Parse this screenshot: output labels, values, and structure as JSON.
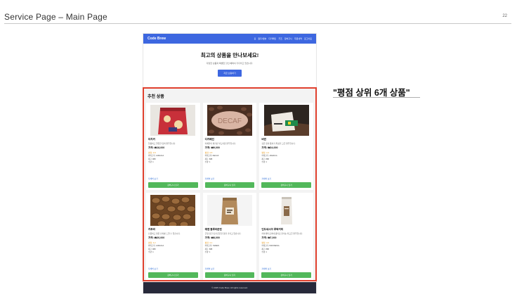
{
  "slide": {
    "title": "Service Page – Main Page",
    "page_number": "22"
  },
  "nav": {
    "brand": "Code Brew",
    "links": [
      "홈",
      "원두/캡슐",
      "디카페인",
      "굿즈",
      "장바구니",
      "주문내역",
      "로그아웃"
    ]
  },
  "hero": {
    "title": "최고의 상품을 만나보세요!",
    "subtitle": "다양한 상품과 특별한 할인 혜택이 기다리고 있습니다.",
    "button": "지금 쇼핑하기"
  },
  "section": {
    "title": "추천 상품"
  },
  "products": [
    {
      "name": "더치커",
      "desc": "달콤하고 깔끔한 맛의 원두입니다.",
      "price": "가격: ₩18,000",
      "rating": "평점: 4.8",
      "meta1": "카테고리: JAMAICA",
      "meta2": "재고: 888",
      "qty": "수량: 1",
      "detail": "자세히 보기",
      "cart": "장바구니 담기",
      "image": "coffee-bag-red"
    },
    {
      "name": "디카페인",
      "desc": "카페인이 제거된 부드러운 원두입니다.",
      "price": "가격: ₩9,000",
      "rating": "평점: 4.5",
      "meta1": "카테고리: DECAF",
      "meta2": "재고: 888",
      "qty": "수량: 1",
      "detail": "자세히 보기",
      "cart": "장바구니 담기",
      "image": "decaf-beans"
    },
    {
      "name": "버번",
      "desc": "깊은 향과 풍미가 특징인 고급 원두입니다.",
      "price": "가격: ₩24,000",
      "rating": "평점: 4.3",
      "meta1": "카테고리: JAMAICA",
      "meta2": "재고: 888",
      "qty": "수량: 1",
      "detail": "자세히 보기",
      "cart": "장바구니 담기",
      "image": "coffee-sack"
    },
    {
      "name": "카투라",
      "desc": "산뜻하고 밝은 산미를 느낄 수 있습니다.",
      "price": "가격: ₩20,000",
      "rating": "평점: 4.2",
      "meta1": "카테고리: JAMAICA",
      "meta2": "재고: 888",
      "qty": "수량: 1",
      "detail": "자세히 보기",
      "cart": "장바구니 담기",
      "image": "roasted-beans"
    },
    {
      "name": "예멘 블루마운틴",
      "desc": "균형 잡힌 맛과 은은한 향을 가지고 있습니다.",
      "price": "가격: ₩8,000",
      "rating": "평점: 4.1",
      "meta1": "카테고리: YEMEN",
      "meta2": "재고: 888",
      "qty": "수량: 1",
      "detail": "자세히 보기",
      "cart": "장바구니 담기",
      "image": "kraft-bag"
    },
    {
      "name": "인도네시아 루왁커피",
      "desc": "커피계의 로마네 콩티로 불리는 최고급 원두입니다.",
      "price": "가격: ₩7,000",
      "rating": "평점: 4.0",
      "meta1": "카테고리: INDONESIA",
      "meta2": "재고: 888",
      "qty": "수량: 1",
      "detail": "자세히 보기",
      "cart": "장바구니 담기",
      "image": "white-pouch"
    }
  ],
  "footer": {
    "text": "© 2025 Code Brew. All rights reserved."
  },
  "annotation": {
    "text": "\"평점 상위 6개 상품\""
  },
  "colors": {
    "nav": "#3d67e0",
    "cart_button": "#52b85b",
    "highlight": "#e0402e",
    "footer": "#27293a",
    "rating": "#e89a1b"
  }
}
